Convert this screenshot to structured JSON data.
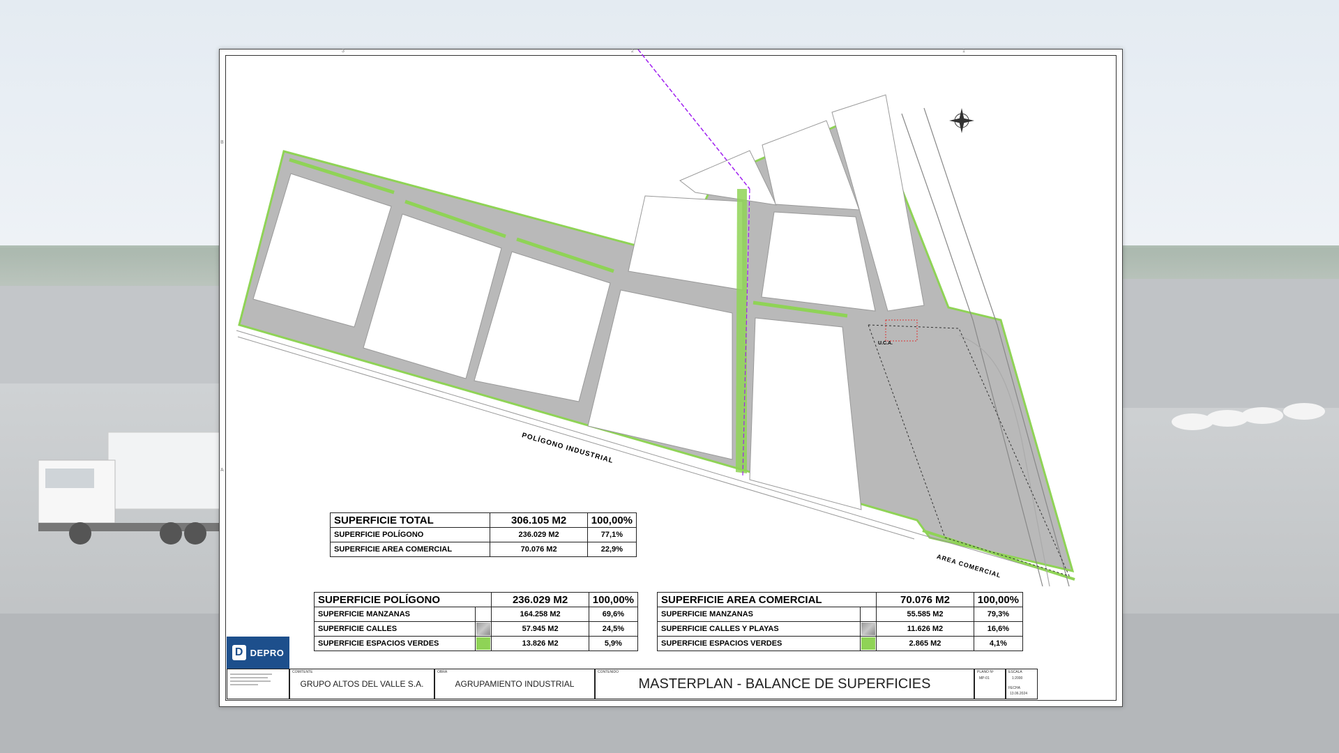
{
  "sheet": {
    "frame_marks": {
      "top": [
        "3",
        "2",
        "1"
      ],
      "left": [
        "B",
        "A"
      ]
    },
    "plan_labels": {
      "poligono": "POLÍGONO INDUSTRIAL",
      "area_comercial": "AREA COMERCIAL",
      "uca": "U.C.A."
    },
    "table_total": {
      "title": "SUPERFICIE TOTAL",
      "area": "306.105 M2",
      "pct": "100,00%",
      "rows": [
        {
          "label": "SUPERFICIE POLÍGONO",
          "area": "236.029 M2",
          "pct": "77,1%"
        },
        {
          "label": "SUPERFICIE AREA COMERCIAL",
          "area": "70.076 M2",
          "pct": "22,9%"
        }
      ]
    },
    "table_poligono": {
      "title": "SUPERFICIE POLÍGONO",
      "area": "236.029 M2",
      "pct": "100,00%",
      "rows": [
        {
          "label": "SUPERFICIE MANZANAS",
          "area": "164.258 M2",
          "pct": "69,6%",
          "swatch": ""
        },
        {
          "label": "SUPERFICIE CALLES",
          "area": "57.945 M2",
          "pct": "24,5%",
          "swatch": "gray"
        },
        {
          "label": "SUPERFICIE ESPACIOS VERDES",
          "area": "13.826 M2",
          "pct": "5,9%",
          "swatch": "green"
        }
      ]
    },
    "table_comercial": {
      "title": "SUPERFICIE AREA COMERCIAL",
      "area": "70.076 M2",
      "pct": "100,00%",
      "rows": [
        {
          "label": "SUPERFICIE MANZANAS",
          "area": "55.585 M2",
          "pct": "79,3%",
          "swatch": ""
        },
        {
          "label": "SUPERFICIE CALLES Y PLAYAS",
          "area": "11.626 M2",
          "pct": "16,6%",
          "swatch": "gray"
        },
        {
          "label": "SUPERFICIE ESPACIOS VERDES",
          "area": "2.865 M2",
          "pct": "4,1%",
          "swatch": "green"
        }
      ]
    },
    "title_block": {
      "logo": "DEPRO",
      "client_caption": "COMITENTE",
      "client": "GRUPO ALTOS DEL VALLE S.A.",
      "project_caption": "OBRA",
      "project": "AGRUPAMIENTO INDUSTRIAL",
      "content_caption": "CONTENIDO",
      "title": "MASTERPLAN - BALANCE DE SUPERFICIES",
      "plano_caption": "PLANO Nº",
      "plano": "MP-01",
      "escala_caption": "ESCALA",
      "escala": "1:2000",
      "fecha_caption": "FECHA",
      "fecha": "13.06.2024"
    },
    "colors": {
      "streets": "#b4b4b4",
      "green_areas": "#8fd356",
      "blocks": "#ffffff",
      "accent_line": "#a020f0",
      "logo_blue": "#1d4f8c"
    }
  }
}
